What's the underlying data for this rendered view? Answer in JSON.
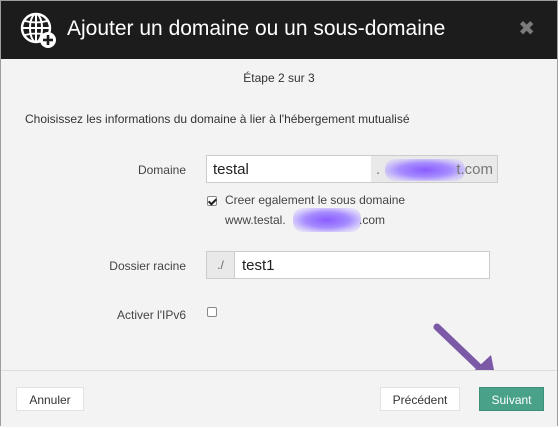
{
  "dialog": {
    "title": "Ajouter un domaine ou un sous-domaine",
    "close_symbol": "✖",
    "globe_icon": "globe-plus-icon"
  },
  "step": {
    "text": "Étape 2 sur 3"
  },
  "instruction": "Choisissez les informations du domaine à lier à l'hébergement mutualisé",
  "form": {
    "domain": {
      "label": "Domaine",
      "value": "testal",
      "suffix_prefix": ".",
      "suffix_tld": "t.com"
    },
    "subdomain_checkbox": {
      "checked": true,
      "label": "Creer egalement le sous domaine",
      "preview_start": "www.testal.",
      "preview_end": ".com"
    },
    "root_folder": {
      "label": "Dossier racine",
      "prefix": "./",
      "value": "test1"
    },
    "ipv6": {
      "label": "Activer l'IPv6",
      "checked": false
    }
  },
  "footer": {
    "cancel_label": "Annuler",
    "previous_label": "Précédent",
    "next_label": "Suivant"
  },
  "colors": {
    "header_bg": "#1c1c1c",
    "primary_button": "#4aa18a",
    "annotation_arrow": "#7b59a6",
    "redaction_blur": "#8a5cff"
  }
}
